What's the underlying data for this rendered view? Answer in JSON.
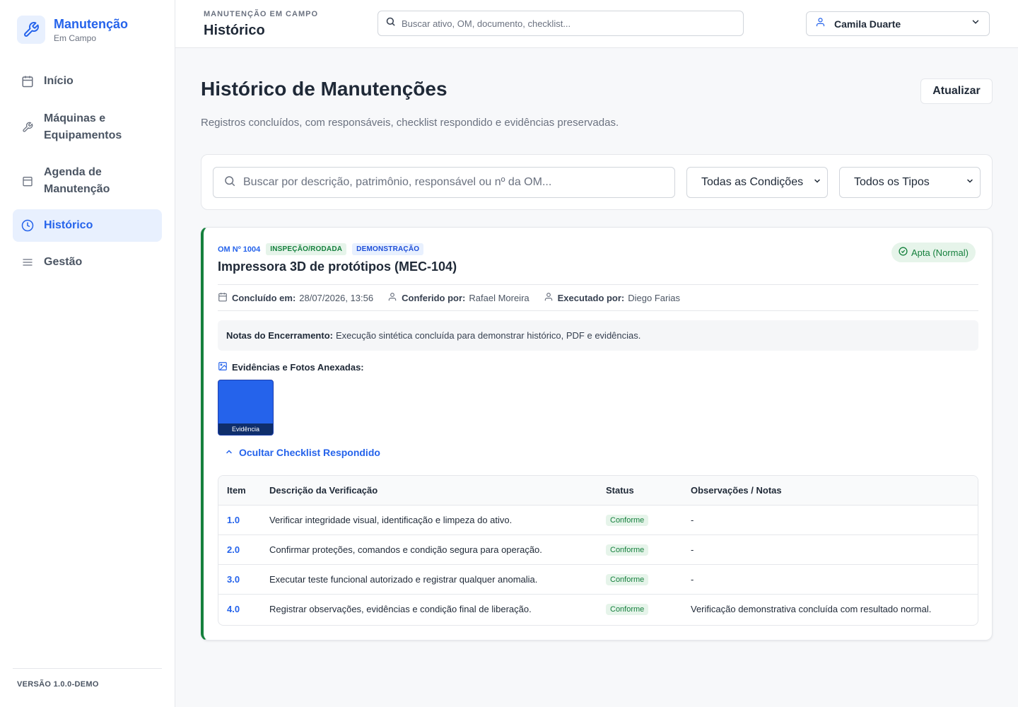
{
  "brand": {
    "title": "Manutenção",
    "subtitle": "Em Campo"
  },
  "nav": {
    "items": [
      {
        "label": "Início",
        "icon": "calendar-icon"
      },
      {
        "label": "Máquinas e Equipamentos",
        "icon": "wrench-icon"
      },
      {
        "label": "Agenda de Manutenção",
        "icon": "calendar-grid-icon"
      },
      {
        "label": "Histórico",
        "icon": "clock-icon",
        "active": true
      },
      {
        "label": "Gestão",
        "icon": "menu-icon"
      }
    ]
  },
  "version": "VERSÃO 1.0.0-DEMO",
  "topbar": {
    "breadcrumb": "MANUTENÇÃO EM CAMPO",
    "title": "Histórico",
    "search_placeholder": "Buscar ativo, OM, documento, checklist...",
    "user_name": "Camila Duarte"
  },
  "page": {
    "title": "Histórico de Manutenções",
    "refresh_label": "Atualizar",
    "subtitle": "Registros concluídos, com responsáveis, checklist respondido e evidências preservadas."
  },
  "filters": {
    "search_placeholder": "Buscar por descrição, patrimônio, responsável ou nº da OM...",
    "condition_selected": "Todas as Condições",
    "type_selected": "Todos os Tipos"
  },
  "record": {
    "om_number": "OM Nº 1004",
    "tags": [
      "INSPEÇÃO/RODADA",
      "DEMONSTRAÇÃO"
    ],
    "title": "Impressora 3D de protótipos (MEC-104)",
    "status": "Apta (Normal)",
    "completed_label": "Concluído em:",
    "completed_value": "28/07/2026, 13:56",
    "checked_label": "Conferido por:",
    "checked_value": "Rafael Moreira",
    "executed_label": "Executado por:",
    "executed_value": "Diego Farias",
    "notes_label": "Notas do Encerramento:",
    "notes_value": "Execução sintética concluída para demonstrar histórico, PDF e evidências.",
    "evidence_heading": "Evidências e Fotos Anexadas:",
    "evidence_caption": "Evidência",
    "toggle_label": "Ocultar Checklist Respondido",
    "colors": {
      "accent": "#2563eb",
      "success": "#15803d"
    }
  },
  "checklist": {
    "headers": [
      "Item",
      "Descrição da Verificação",
      "Status",
      "Observações / Notas"
    ],
    "rows": [
      {
        "item": "1.0",
        "description": "Verificar integridade visual, identificação e limpeza do ativo.",
        "status": "Conforme",
        "notes": "-"
      },
      {
        "item": "2.0",
        "description": "Confirmar proteções, comandos e condição segura para operação.",
        "status": "Conforme",
        "notes": "-"
      },
      {
        "item": "3.0",
        "description": "Executar teste funcional autorizado e registrar qualquer anomalia.",
        "status": "Conforme",
        "notes": "-"
      },
      {
        "item": "4.0",
        "description": "Registrar observações, evidências e condição final de liberação.",
        "status": "Conforme",
        "notes": "Verificação demonstrativa concluída com resultado normal."
      }
    ]
  }
}
